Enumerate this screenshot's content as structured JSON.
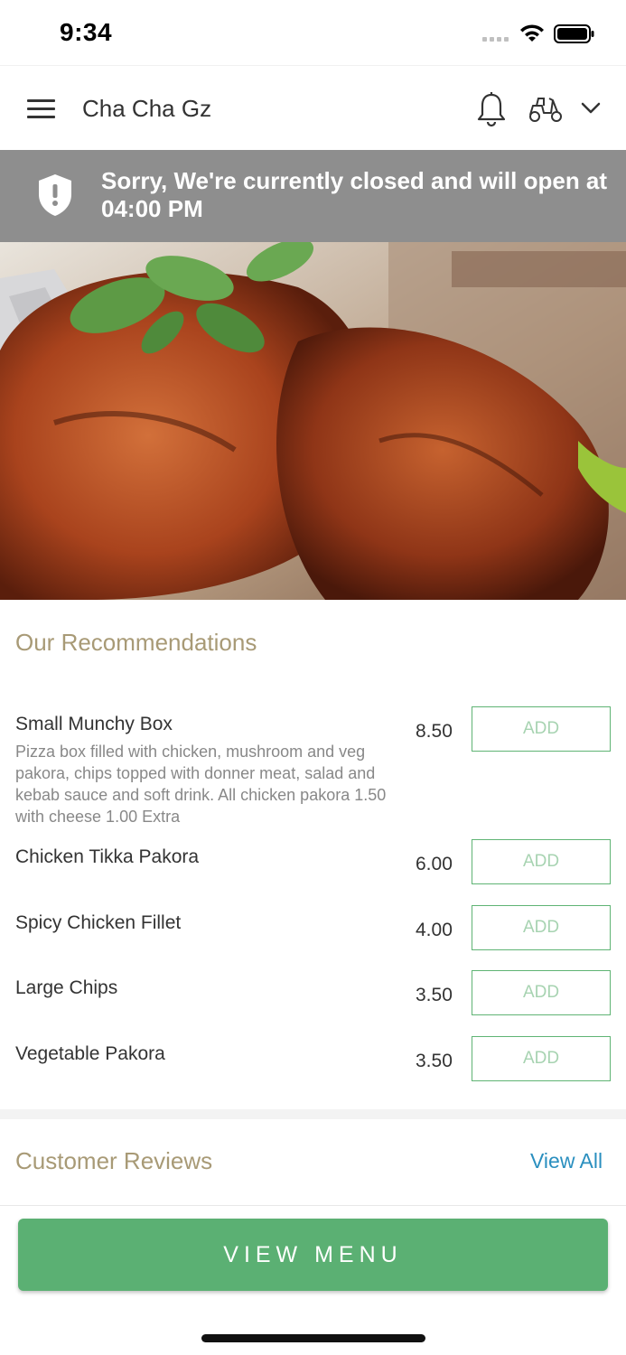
{
  "status_bar": {
    "time": "9:34"
  },
  "header": {
    "title": "Cha Cha Gz",
    "menu_icon": "hamburger-menu-icon",
    "bell_icon": "bell-icon",
    "delivery_icon": "scooter-icon",
    "dropdown_icon": "chevron-down-icon"
  },
  "banner": {
    "icon": "shield-alert-icon",
    "message": "Sorry, We're currently closed and will open at 04:00 PM"
  },
  "recommendations": {
    "title": "Our Recommendations",
    "items": [
      {
        "name": "Small Munchy Box",
        "description": "Pizza box filled with chicken, mushroom and veg pakora, chips topped with donner meat, salad and kebab sauce and soft drink. All chicken pakora 1.50 with cheese 1.00 Extra",
        "price": "8.50",
        "add_label": "ADD"
      },
      {
        "name": "Chicken Tikka Pakora",
        "description": "",
        "price": "6.00",
        "add_label": "ADD"
      },
      {
        "name": "Spicy Chicken Fillet",
        "description": "",
        "price": "4.00",
        "add_label": "ADD"
      },
      {
        "name": "Large Chips",
        "description": "",
        "price": "3.50",
        "add_label": "ADD"
      },
      {
        "name": "Vegetable Pakora",
        "description": "",
        "price": "3.50",
        "add_label": "ADD"
      }
    ]
  },
  "reviews": {
    "title": "Customer Reviews",
    "view_all_label": "View All"
  },
  "footer": {
    "view_menu_label": "VIEW MENU"
  },
  "colors": {
    "accent_green": "#5bb073",
    "section_title": "#a89a76",
    "link_blue": "#2a8fbf",
    "banner_gray": "#8e8e8e"
  }
}
